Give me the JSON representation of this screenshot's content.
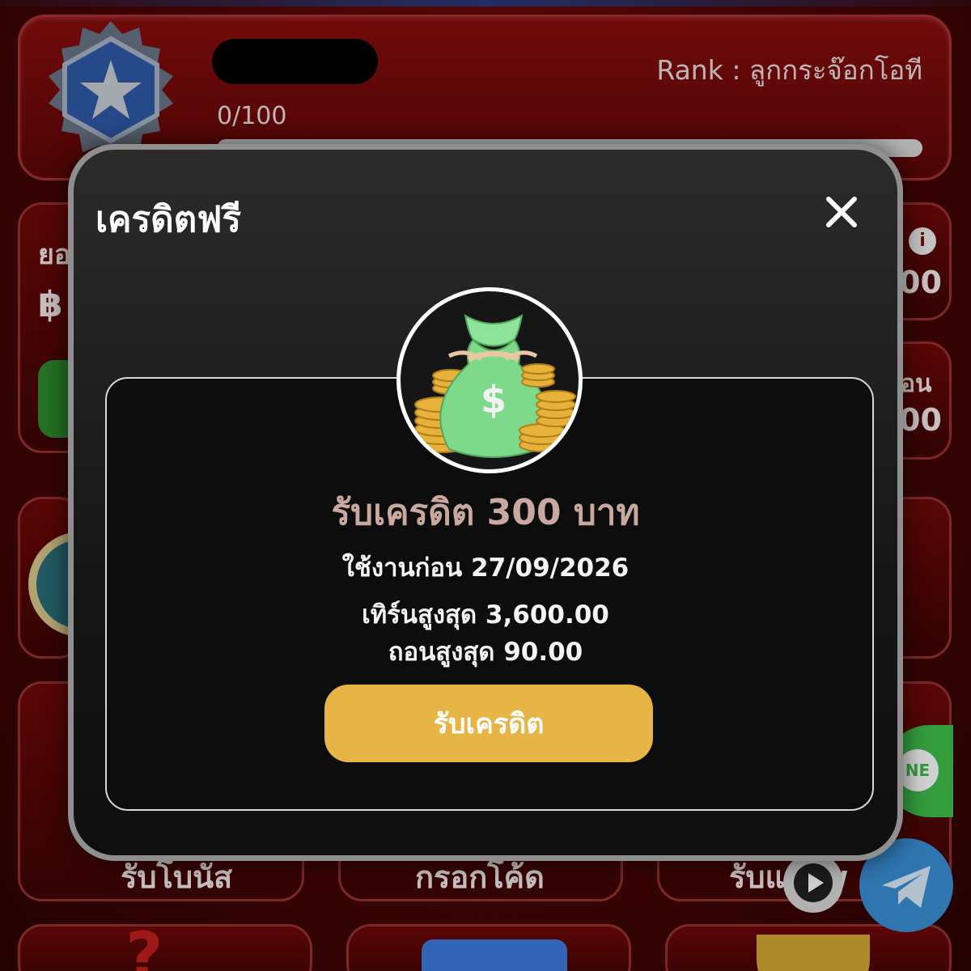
{
  "profile": {
    "rank_label": "Rank : ลูกกระจ๊อกโอที",
    "level_progress_text": "0/100",
    "level_progress_fraction": 0.0
  },
  "background": {
    "left_balance_label": "ยอ",
    "left_currency": "฿",
    "right_value_1": "00",
    "right_label_2": "อน",
    "right_value_2": "00",
    "tile_label_1": "รับโบนัส",
    "tile_label_2": "กรอกโค้ด",
    "tile_label_3": "รับแ...w",
    "line_text": "NE"
  },
  "modal": {
    "title": "เครดิตฟรี",
    "reward_title": "รับเครดิต 300 บาท",
    "use_before": "ใช้งานก่อน 27/09/2026",
    "max_turnover": "เทิร์นสูงสุด 3,600.00",
    "max_withdraw": "ถอนสูงสุด 90.00",
    "claim_label": "รับเครดิต"
  },
  "icons": {
    "close": "close-icon",
    "money_bag": "money-bag-icon",
    "telegram": "telegram-icon",
    "play": "play-icon",
    "line": "line-icon"
  },
  "colors": {
    "accent_button": "#e6b545",
    "reward_title": "#c9a8a0",
    "background_red": "#6e0808"
  }
}
